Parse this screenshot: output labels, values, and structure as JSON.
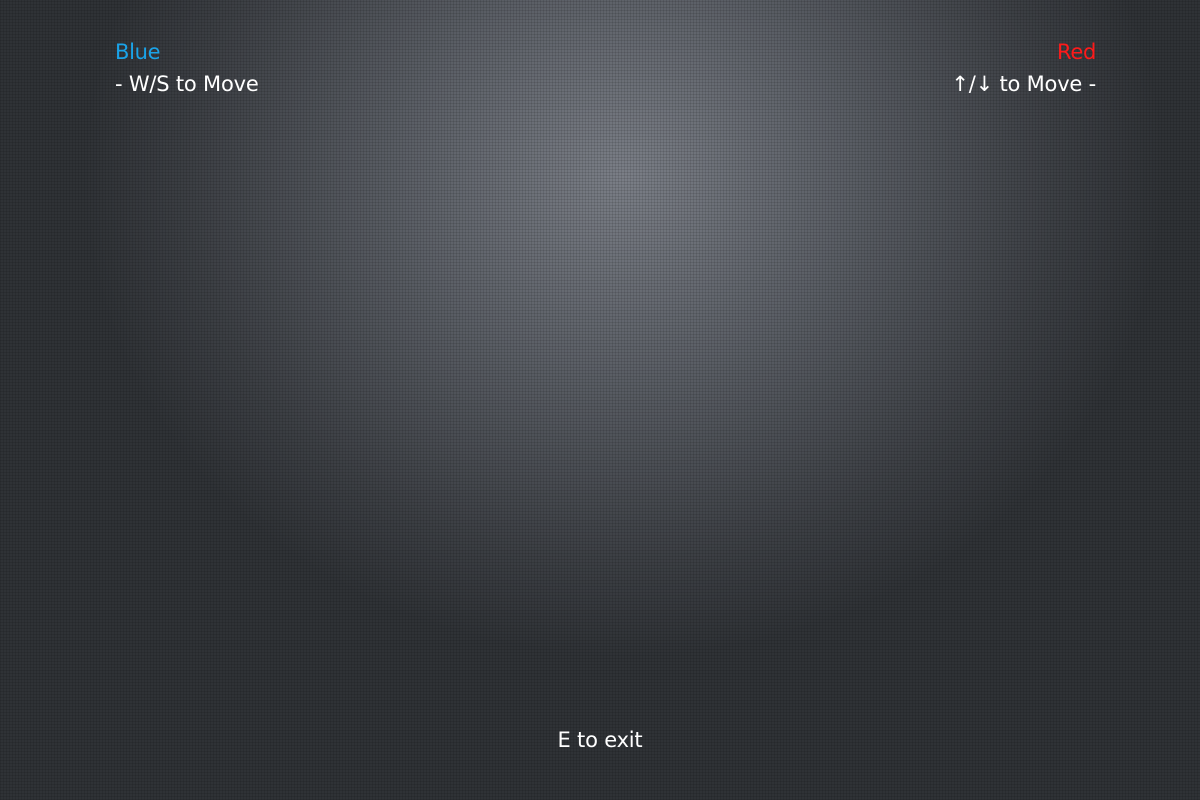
{
  "players": {
    "left": {
      "name": "Blue",
      "color": "#1aa3e8",
      "controls": "- W/S to Move"
    },
    "right": {
      "name": "Red",
      "color": "#ff1a1a",
      "controls": "↑/↓ to Move -"
    }
  },
  "footer": {
    "exit_hint": "E to exit"
  },
  "background": {
    "texture": "dark gray mesh with radial vignette"
  }
}
